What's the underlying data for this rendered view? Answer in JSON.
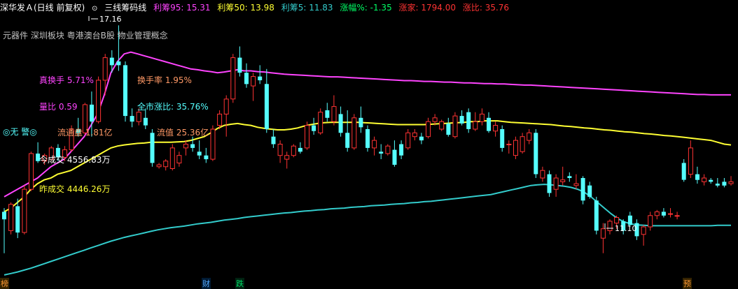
{
  "header": {
    "title": "深华发Ａ(日线 前复权)",
    "indicator": "三线筹码线",
    "items": [
      {
        "label": "利筹95: 15.31",
        "color": "#ff44ff"
      },
      {
        "label": "利筹50: 13.98",
        "color": "#ffff33"
      },
      {
        "label": "利筹5: 11.83",
        "color": "#33cccc"
      },
      {
        "label": "涨幅%: -1.35",
        "color": "#00ff66"
      },
      {
        "label": "涨家: 1794.00",
        "color": "#ff3333"
      },
      {
        "label": "涨比: 35.76",
        "color": "#ff3333"
      }
    ]
  },
  "concepts": "元器件 深圳板块 粤港澳台B股 物业管理概念",
  "labels": {
    "turnover_real": "真换手 5.71%",
    "turnover": "换手率 1.95%",
    "volume_ratio": "量比 0.59",
    "market_ratio": "全市涨比: 35.76%",
    "float_cap": "流通盘 1.81亿",
    "float_value": "流值 25.36亿",
    "alert": "◎无 警◎",
    "today_amount": "今成交 4556.83万",
    "yesterday_amount": "昨成交 4446.26万"
  },
  "markers": {
    "m1": "榜",
    "m2": "财",
    "m3": "跌",
    "m4": "预"
  },
  "chart_data": {
    "type": "candlestick",
    "ylim": [
      10.5,
      17.5
    ],
    "price_labels": {
      "high": "17.16",
      "low": "11.10"
    },
    "colors": {
      "up": "#ff3333",
      "down": "#55ffff",
      "line95": "#ff44ff",
      "line50": "#ffff33",
      "line5": "#33cccc"
    },
    "candles": [
      [
        12.2,
        12.3,
        11.1,
        12.0
      ],
      [
        11.7,
        12.45,
        11.6,
        12.4
      ],
      [
        12.35,
        12.55,
        11.5,
        11.65
      ],
      [
        11.65,
        12.9,
        11.6,
        12.8
      ],
      [
        12.8,
        13.8,
        12.75,
        13.75
      ],
      [
        13.75,
        14.05,
        13.5,
        13.55
      ],
      [
        13.55,
        13.75,
        13.45,
        13.7
      ],
      [
        13.6,
        13.95,
        13.55,
        13.9
      ],
      [
        13.9,
        14.0,
        13.55,
        13.65
      ],
      [
        13.65,
        13.95,
        13.55,
        13.85
      ],
      [
        13.85,
        14.5,
        13.8,
        14.4
      ],
      [
        14.4,
        14.7,
        14.2,
        14.3
      ],
      [
        14.3,
        15.1,
        14.25,
        15.05
      ],
      [
        15.05,
        15.4,
        14.2,
        14.6
      ],
      [
        14.6,
        15.8,
        14.55,
        15.7
      ],
      [
        15.7,
        16.4,
        15.3,
        16.3
      ],
      [
        16.3,
        16.5,
        15.9,
        16.1
      ],
      [
        16.2,
        17.16,
        15.95,
        16.1
      ],
      [
        16.1,
        16.2,
        14.6,
        14.75
      ],
      [
        14.75,
        14.95,
        14.45,
        14.6
      ],
      [
        14.6,
        14.95,
        14.5,
        14.85
      ],
      [
        14.7,
        14.95,
        14.4,
        14.5
      ],
      [
        14.3,
        14.4,
        13.4,
        13.5
      ],
      [
        13.4,
        13.5,
        13.35,
        13.45
      ],
      [
        13.4,
        13.6,
        13.3,
        13.55
      ],
      [
        13.35,
        14.0,
        13.3,
        13.9
      ],
      [
        13.5,
        13.8,
        13.4,
        13.7
      ],
      [
        13.9,
        14.1,
        13.7,
        14.0
      ],
      [
        14.0,
        14.2,
        13.8,
        13.9
      ],
      [
        13.8,
        14.1,
        13.6,
        13.7
      ],
      [
        13.7,
        13.9,
        13.5,
        13.6
      ],
      [
        13.6,
        14.5,
        13.55,
        14.4
      ],
      [
        14.5,
        14.9,
        14.4,
        14.8
      ],
      [
        14.8,
        15.3,
        14.2,
        15.2
      ],
      [
        15.2,
        16.4,
        15.1,
        16.3
      ],
      [
        16.3,
        16.6,
        15.8,
        15.9
      ],
      [
        15.9,
        16.15,
        15.5,
        15.6
      ],
      [
        15.55,
        15.9,
        15.15,
        15.8
      ],
      [
        15.8,
        16.1,
        15.6,
        15.7
      ],
      [
        15.6,
        16.0,
        14.3,
        14.4
      ],
      [
        14.2,
        14.4,
        13.9,
        14.0
      ],
      [
        13.7,
        14.1,
        13.5,
        14.0
      ],
      [
        13.6,
        13.8,
        13.35,
        13.7
      ],
      [
        13.7,
        14.0,
        13.65,
        13.95
      ],
      [
        13.9,
        14.05,
        13.75,
        13.8
      ],
      [
        13.9,
        14.6,
        13.85,
        14.5
      ],
      [
        14.5,
        14.7,
        14.25,
        14.35
      ],
      [
        14.3,
        14.95,
        14.25,
        14.85
      ],
      [
        14.9,
        15.1,
        14.6,
        14.7
      ],
      [
        14.6,
        15.3,
        14.5,
        15.0
      ],
      [
        14.8,
        15.0,
        14.2,
        14.3
      ],
      [
        14.3,
        14.9,
        13.8,
        13.9
      ],
      [
        13.9,
        14.8,
        13.85,
        14.7
      ],
      [
        14.7,
        15.0,
        14.3,
        14.45
      ],
      [
        14.4,
        14.5,
        13.8,
        13.9
      ],
      [
        13.9,
        14.2,
        13.7,
        14.1
      ],
      [
        13.8,
        14.0,
        13.6,
        13.75
      ],
      [
        13.75,
        14.0,
        13.7,
        13.95
      ],
      [
        13.85,
        14.1,
        13.4,
        13.45
      ],
      [
        14.0,
        14.1,
        13.6,
        13.7
      ],
      [
        13.9,
        14.4,
        13.85,
        14.3
      ],
      [
        14.2,
        14.4,
        14.1,
        14.3
      ],
      [
        14.2,
        14.3,
        14.0,
        14.1
      ],
      [
        14.2,
        14.7,
        14.15,
        14.6
      ],
      [
        14.6,
        14.8,
        14.5,
        14.7
      ],
      [
        14.4,
        14.65,
        14.35,
        14.6
      ],
      [
        14.55,
        14.7,
        14.2,
        14.25
      ],
      [
        14.2,
        14.85,
        14.15,
        14.75
      ],
      [
        14.75,
        14.9,
        14.5,
        14.55
      ],
      [
        14.85,
        14.95,
        14.3,
        14.4
      ],
      [
        14.4,
        14.85,
        14.35,
        14.6
      ],
      [
        14.6,
        14.95,
        14.5,
        14.8
      ],
      [
        14.7,
        14.85,
        14.3,
        14.35
      ],
      [
        14.35,
        14.6,
        14.2,
        14.5
      ],
      [
        14.4,
        14.5,
        13.8,
        13.9
      ],
      [
        14.0,
        14.1,
        13.75,
        14.0
      ],
      [
        13.7,
        14.2,
        13.6,
        14.1
      ],
      [
        13.8,
        14.3,
        13.75,
        14.2
      ],
      [
        14.1,
        14.4,
        14.0,
        14.3
      ],
      [
        14.3,
        14.4,
        13.1,
        13.2
      ],
      [
        13.1,
        13.4,
        13.0,
        13.3
      ],
      [
        13.2,
        13.3,
        12.6,
        12.7
      ],
      [
        12.8,
        13.2,
        12.6,
        13.1
      ],
      [
        13.0,
        13.4,
        12.9,
        13.05
      ],
      [
        13.15,
        13.25,
        13.0,
        13.1
      ],
      [
        12.9,
        13.2,
        12.8,
        12.95
      ],
      [
        13.1,
        13.15,
        12.4,
        12.5
      ],
      [
        12.9,
        13.0,
        12.55,
        12.6
      ],
      [
        12.5,
        12.6,
        11.6,
        11.7
      ],
      [
        11.5,
        11.9,
        11.1,
        11.75
      ],
      [
        11.7,
        12.0,
        11.6,
        11.95
      ],
      [
        11.9,
        12.1,
        11.75,
        12.05
      ],
      [
        11.95,
        12.0,
        11.6,
        11.7
      ],
      [
        12.1,
        12.2,
        11.8,
        11.85
      ],
      [
        11.9,
        12.0,
        11.45,
        11.55
      ],
      [
        11.6,
        11.85,
        11.3,
        11.8
      ],
      [
        11.8,
        12.2,
        11.7,
        12.1
      ],
      [
        12.1,
        12.25,
        12.0,
        12.2
      ],
      [
        12.2,
        12.3,
        12.05,
        12.1
      ],
      [
        12.15,
        12.3,
        12.05,
        12.15
      ],
      [
        12.1,
        12.2,
        12.0,
        12.1
      ],
      [
        13.5,
        13.6,
        13.0,
        13.05
      ],
      [
        13.2,
        14.1,
        13.1,
        13.9
      ],
      [
        13.2,
        13.4,
        12.95,
        13.05
      ],
      [
        13.0,
        13.2,
        12.9,
        13.1
      ],
      [
        13.05,
        13.1,
        12.95,
        13.0
      ],
      [
        12.95,
        13.1,
        12.85,
        12.9
      ],
      [
        13.0,
        13.1,
        12.85,
        12.9
      ],
      [
        12.95,
        13.15,
        12.9,
        13.0
      ]
    ],
    "line95": [
      12.6,
      12.7,
      12.8,
      12.9,
      13.0,
      13.1,
      13.25,
      13.4,
      13.5,
      13.6,
      13.8,
      14.0,
      14.2,
      14.5,
      14.8,
      15.3,
      15.9,
      16.2,
      16.4,
      16.45,
      16.4,
      16.35,
      16.3,
      16.25,
      16.2,
      16.15,
      16.1,
      16.05,
      16.0,
      15.98,
      15.95,
      15.93,
      15.9,
      15.92,
      15.95,
      15.98,
      15.95,
      15.95,
      15.93,
      15.92,
      15.9,
      15.88,
      15.86,
      15.85,
      15.84,
      15.83,
      15.82,
      15.81,
      15.8,
      15.79,
      15.79,
      15.78,
      15.77,
      15.76,
      15.75,
      15.74,
      15.73,
      15.72,
      15.71,
      15.7,
      15.69,
      15.69,
      15.68,
      15.67,
      15.67,
      15.66,
      15.65,
      15.65,
      15.64,
      15.63,
      15.63,
      15.62,
      15.61,
      15.61,
      15.6,
      15.6,
      15.59,
      15.58,
      15.57,
      15.57,
      15.56,
      15.55,
      15.54,
      15.53,
      15.52,
      15.51,
      15.5,
      15.49,
      15.48,
      15.47,
      15.46,
      15.45,
      15.44,
      15.43,
      15.42,
      15.41,
      15.4,
      15.39,
      15.38,
      15.37,
      15.36,
      15.35,
      15.34,
      15.33,
      15.32,
      15.32,
      15.31,
      15.31,
      15.31,
      15.31
    ],
    "line50": [
      12.2,
      12.3,
      12.45,
      12.6,
      12.8,
      12.95,
      13.05,
      13.1,
      13.2,
      13.25,
      13.3,
      13.4,
      13.5,
      13.6,
      13.7,
      13.8,
      13.9,
      13.95,
      13.98,
      14.0,
      14.02,
      14.03,
      14.05,
      14.05,
      14.05,
      14.05,
      14.06,
      14.07,
      14.1,
      14.15,
      14.2,
      14.3,
      14.42,
      14.5,
      14.53,
      14.55,
      14.52,
      14.5,
      14.45,
      14.42,
      14.4,
      14.38,
      14.38,
      14.4,
      14.43,
      14.48,
      14.52,
      14.55,
      14.57,
      14.58,
      14.58,
      14.58,
      14.58,
      14.58,
      14.57,
      14.56,
      14.55,
      14.54,
      14.53,
      14.52,
      14.52,
      14.52,
      14.52,
      14.52,
      14.53,
      14.54,
      14.55,
      14.56,
      14.57,
      14.58,
      14.6,
      14.6,
      14.62,
      14.62,
      14.62,
      14.6,
      14.58,
      14.57,
      14.56,
      14.55,
      14.54,
      14.53,
      14.52,
      14.5,
      14.48,
      14.47,
      14.45,
      14.43,
      14.42,
      14.4,
      14.38,
      14.37,
      14.35,
      14.33,
      14.32,
      14.3,
      14.28,
      14.27,
      14.25,
      14.23,
      14.22,
      14.2,
      14.18,
      14.16,
      14.14,
      14.12,
      14.1,
      14.05,
      14.0,
      13.98
    ],
    "line5": [
      10.52,
      10.56,
      10.6,
      10.65,
      10.7,
      10.76,
      10.82,
      10.88,
      10.94,
      11.0,
      11.06,
      11.12,
      11.18,
      11.24,
      11.3,
      11.36,
      11.42,
      11.47,
      11.52,
      11.56,
      11.6,
      11.64,
      11.68,
      11.72,
      11.75,
      11.78,
      11.8,
      11.82,
      11.85,
      11.88,
      11.9,
      11.92,
      11.95,
      11.98,
      12.0,
      12.02,
      12.05,
      12.07,
      12.09,
      12.11,
      12.13,
      12.15,
      12.17,
      12.18,
      12.2,
      12.22,
      12.23,
      12.25,
      12.26,
      12.28,
      12.29,
      12.3,
      12.32,
      12.33,
      12.34,
      12.36,
      12.37,
      12.38,
      12.4,
      12.41,
      12.42,
      12.44,
      12.45,
      12.47,
      12.48,
      12.5,
      12.52,
      12.54,
      12.56,
      12.58,
      12.6,
      12.62,
      12.64,
      12.66,
      12.7,
      12.74,
      12.78,
      12.82,
      12.86,
      12.9,
      12.92,
      12.93,
      12.92,
      12.9,
      12.88,
      12.85,
      12.8,
      12.72,
      12.6,
      12.45,
      12.3,
      12.15,
      12.02,
      11.93,
      11.88,
      11.85,
      11.84,
      11.83,
      11.83,
      11.83,
      11.83,
      11.83,
      11.83,
      11.83,
      11.83,
      11.83,
      11.83,
      11.84,
      11.84,
      11.84
    ]
  }
}
